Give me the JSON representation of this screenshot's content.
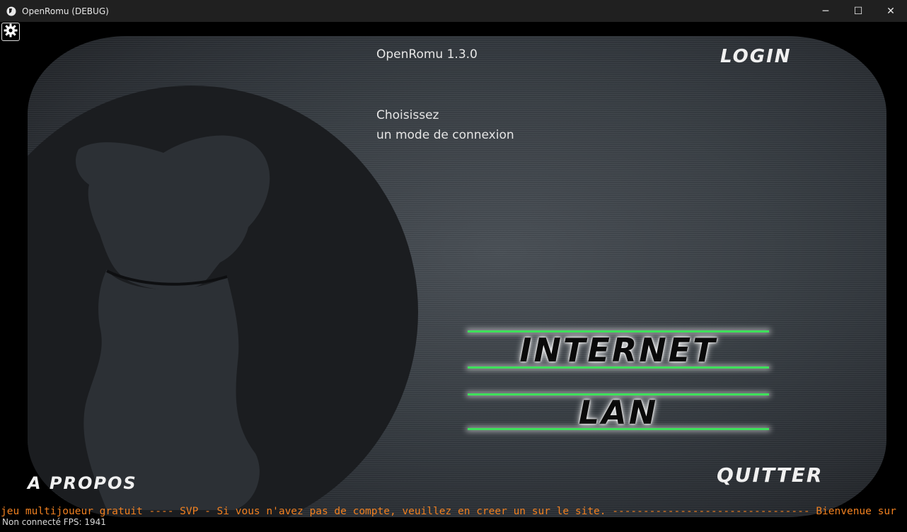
{
  "window": {
    "title": "OpenRomu (DEBUG)",
    "minimize_glyph": "─",
    "maximize_glyph": "☐",
    "close_glyph": "✕"
  },
  "header": {
    "version": "OpenRomu 1.3.0",
    "login_label": "LOGIN"
  },
  "prompt": {
    "line1": "Choisissez",
    "line2": "un mode de connexion"
  },
  "modes": {
    "internet_label": "INTERNET",
    "lan_label": "LAN"
  },
  "footer": {
    "apropos_label": "A PROPOS",
    "quitter_label": "QUITTER",
    "ticker_text": "jeu multijoueur gratuit ---- SVP - Si vous n'avez pas de compte, veuillez en creer un sur le site. -------------------------------- Bienvenue sur",
    "status_text": "Non connecté FPS: 1941"
  },
  "icons": {
    "app": "app-logo-icon",
    "settings": "gear-icon"
  },
  "colors": {
    "accent_green": "#3ee05a",
    "ticker_orange": "#f08020"
  }
}
